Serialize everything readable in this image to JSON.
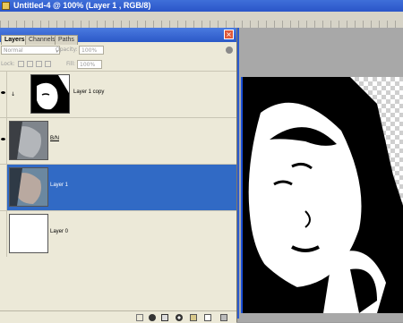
{
  "window": {
    "title": "Untitled-4 @ 100% (Layer 1 , RGB/8)"
  },
  "layers_panel": {
    "tabs": [
      {
        "label": "Layers",
        "active": true
      },
      {
        "label": "Channels",
        "active": false
      },
      {
        "label": "Paths",
        "active": false
      }
    ],
    "blend_mode": "Normal",
    "opacity_label": "Opacity:",
    "opacity_value": "100%",
    "lock_label": "Lock:",
    "fill_label": "Fill:",
    "fill_value": "100%",
    "layers": [
      {
        "name": "Layer 1 copy",
        "visible": true,
        "selected": false,
        "thumb": "halftone-face"
      },
      {
        "name": "B/N",
        "visible": true,
        "selected": false,
        "thumb": "gray-face"
      },
      {
        "name": "Layer 1",
        "visible": false,
        "selected": true,
        "thumb": "color-face"
      },
      {
        "name": "Layer 0",
        "visible": false,
        "selected": false,
        "thumb": "white"
      }
    ],
    "bottom_icons": [
      "link-icon",
      "fx-icon",
      "mask-icon",
      "adjustment-icon",
      "folder-icon",
      "new-layer-icon",
      "trash-icon"
    ]
  },
  "colors": {
    "selection": "#316ac5",
    "titlebar": "#2a55c8",
    "panel": "#ece9d8"
  }
}
